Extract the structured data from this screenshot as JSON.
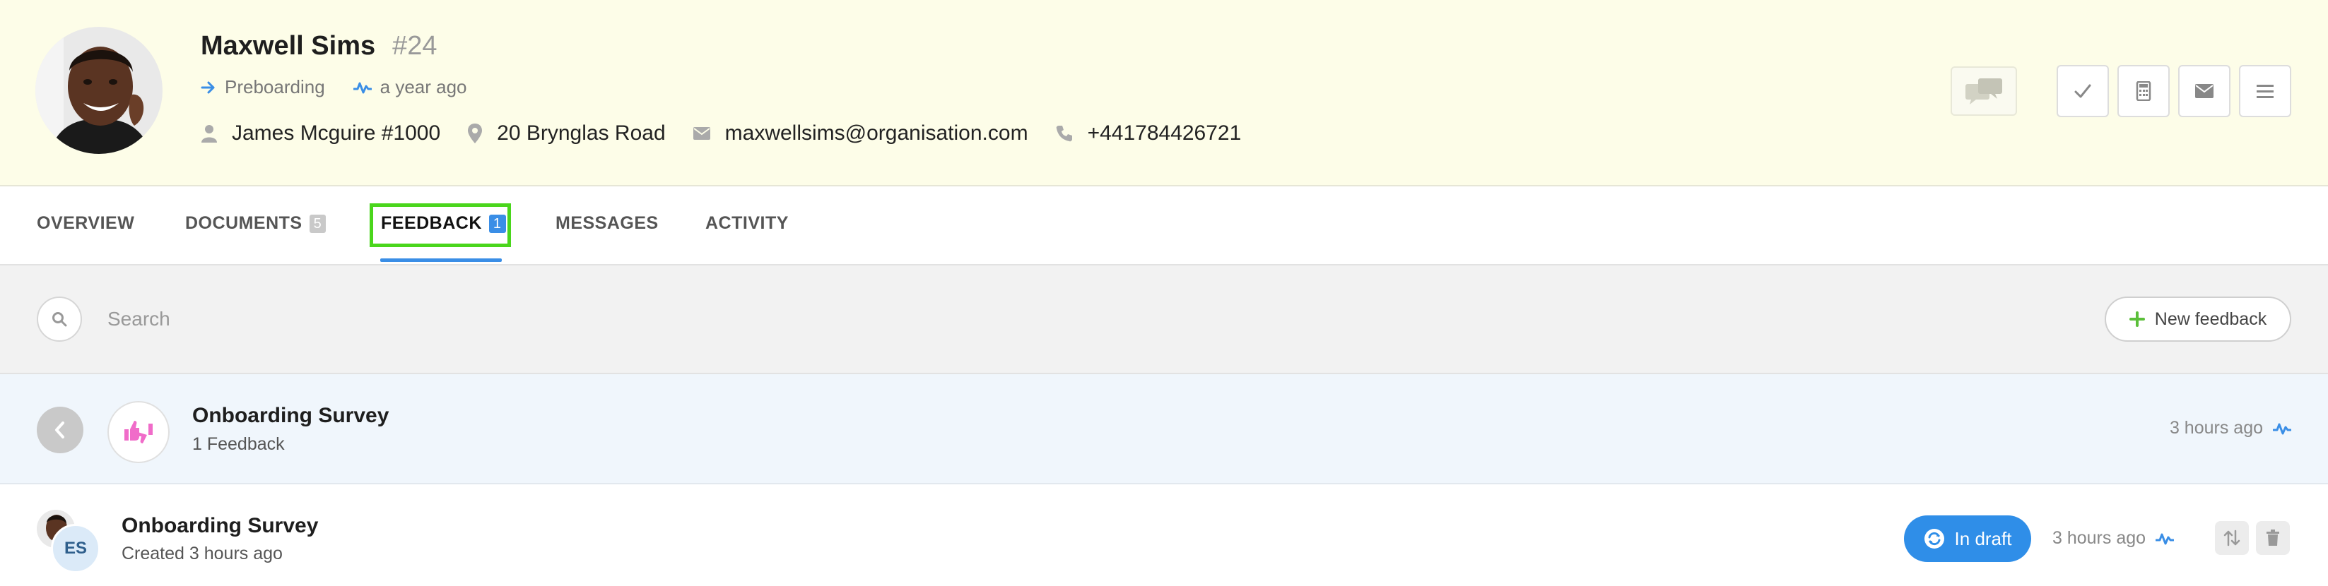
{
  "profile": {
    "name": "Maxwell Sims",
    "number": "#24",
    "stage": "Preboarding",
    "activity": "a year ago",
    "manager": "James Mcguire #1000",
    "address": "20 Brynglas Road",
    "email": "maxwellsims@organisation.com",
    "phone": "+441784426721"
  },
  "tabs": [
    {
      "label": "OVERVIEW"
    },
    {
      "label": "DOCUMENTS",
      "count": "5"
    },
    {
      "label": "FEEDBACK",
      "count": "1"
    },
    {
      "label": "MESSAGES"
    },
    {
      "label": "ACTIVITY"
    }
  ],
  "search": {
    "placeholder": "Search",
    "value": ""
  },
  "new_feedback_label": "New feedback",
  "survey_group": {
    "title": "Onboarding Survey",
    "subtitle": "1 Feedback",
    "time": "3 hours ago"
  },
  "feedback_row": {
    "initials": "ES",
    "title": "Onboarding Survey",
    "subtitle": "Created 3 hours ago",
    "status": "In draft",
    "time": "3 hours ago"
  },
  "colors": {
    "header_bg": "#fdfde8",
    "accent": "#3a8ee6",
    "highlight_frame": "#4ad61c",
    "thumbs": "#f06cc9",
    "add_icon": "#5bbf3a"
  },
  "icons": [
    "arrow-right-icon",
    "activity-icon",
    "user-icon",
    "location-pin-icon",
    "envelope-icon",
    "phone-icon",
    "chat-bubbles-icon",
    "check-icon",
    "calculator-icon",
    "mail-icon",
    "menu-icon",
    "search-icon",
    "plus-icon",
    "chevron-left-icon",
    "thumbs-icon",
    "refresh-icon",
    "sort-icon",
    "trash-icon"
  ]
}
